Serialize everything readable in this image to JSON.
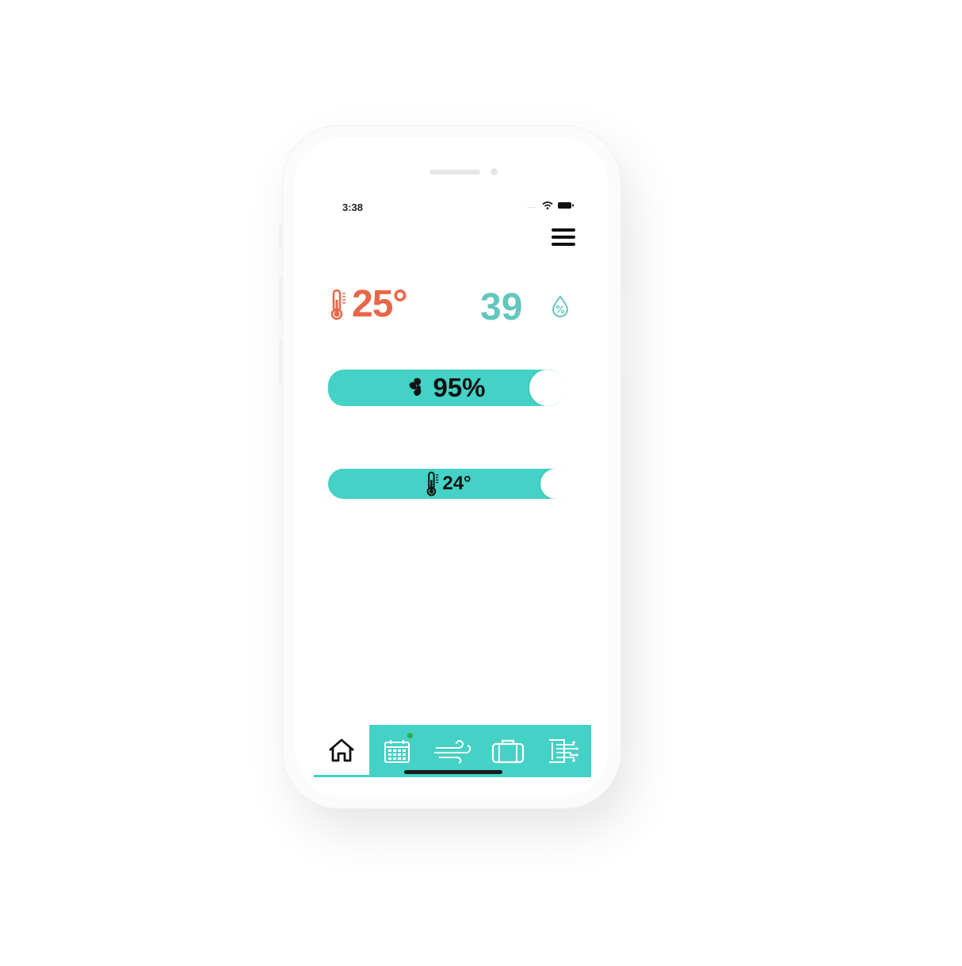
{
  "status_bar": {
    "time": "3:38"
  },
  "readings": {
    "temperature": "25°",
    "humidity": "39"
  },
  "sliders": {
    "fan": {
      "label": "95%",
      "level_percent": 95
    },
    "setpoint": {
      "label": "24°"
    }
  },
  "tabs": [
    {
      "icon": "home-icon"
    },
    {
      "icon": "calendar-icon"
    },
    {
      "icon": "wind-icon"
    },
    {
      "icon": "suitcase-icon"
    },
    {
      "icon": "settings-panel-icon"
    }
  ],
  "colors": {
    "temperature": "#ea6648",
    "humidity": "#62c7bd",
    "accent": "#43d2c5"
  }
}
